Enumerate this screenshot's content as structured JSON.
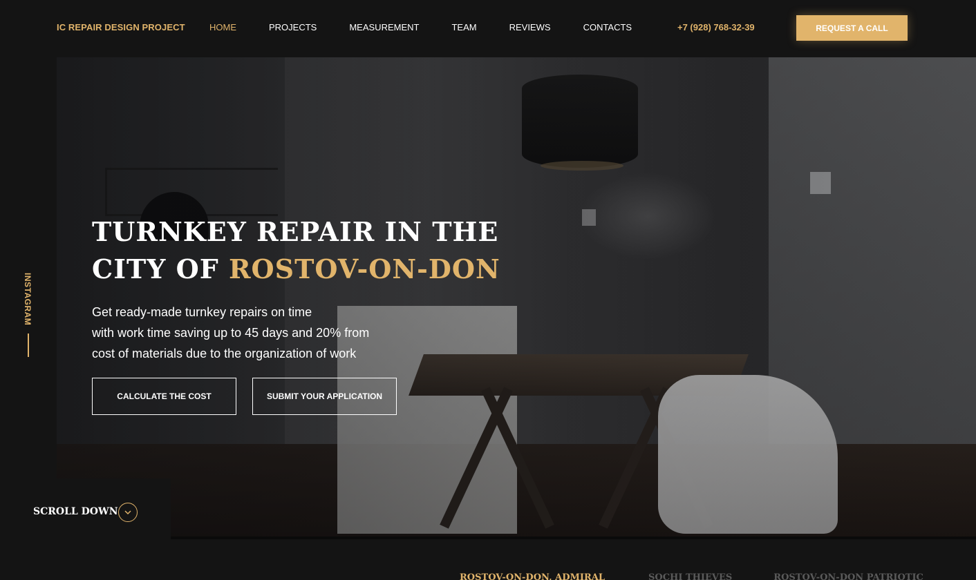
{
  "header": {
    "logo": "IC REPAIR DESIGN PROJECT",
    "nav": [
      {
        "label": "HOME",
        "active": true
      },
      {
        "label": "PROJECTS",
        "active": false
      },
      {
        "label": "MEASUREMENT",
        "active": false
      },
      {
        "label": "TEAM",
        "active": false
      },
      {
        "label": "REVIEWS",
        "active": false
      },
      {
        "label": "CONTACTS",
        "active": false
      }
    ],
    "phone": "+7 (928) 768-32-39",
    "cta_label": "REQUEST A CALL"
  },
  "hero": {
    "title_line1": "TURNKEY REPAIR IN THE",
    "title_line2_prefix": "CITY OF ",
    "title_line2_accent": "ROSTOV-ON-DON",
    "subtitle": [
      "Get ready-made turnkey repairs on time",
      "with work time saving up to 45 days and 20% from",
      "cost of materials due to the organization of work"
    ],
    "calc_button": "CALCULATE THE COST",
    "submit_button": "SUBMIT YOUR APPLICATION"
  },
  "social": {
    "instagram": "INSTAGRAM"
  },
  "scroll": {
    "label": "SCROLL DOWN",
    "icon": "chevron-down-icon"
  },
  "projects": {
    "tabs": [
      {
        "label": "ROSTOV-ON-DON, ADMIRAL",
        "active": true
      },
      {
        "label": "SOCHI THIEVES",
        "active": false
      },
      {
        "label": "ROSTOV-ON-DON PATRIOTIC",
        "active": false
      }
    ]
  },
  "colors": {
    "accent": "#e1b46b",
    "background": "#141414",
    "text": "#ffffff"
  }
}
